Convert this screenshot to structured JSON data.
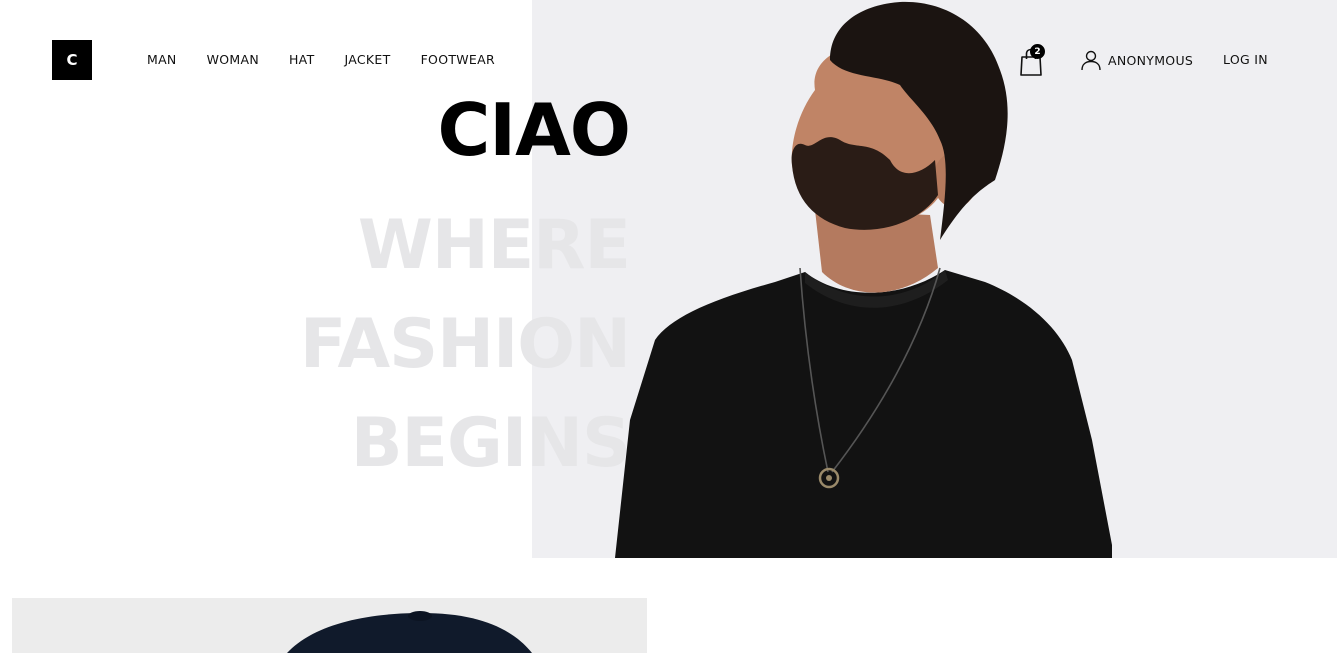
{
  "brand": {
    "logo_letter": "C"
  },
  "nav": {
    "items": [
      {
        "label": "MAN"
      },
      {
        "label": "WOMAN"
      },
      {
        "label": "HAT"
      },
      {
        "label": "JACKET"
      },
      {
        "label": "FOOTWEAR"
      }
    ]
  },
  "header": {
    "cart_count": "2",
    "account_label": "ANONYMOUS",
    "login_label": "LOG IN"
  },
  "hero": {
    "title": "CIAO",
    "tagline_lines": [
      "WHERE",
      "FASHION",
      "BEGINS"
    ]
  },
  "colors": {
    "hero_background": "#efeff2",
    "tagline": "#e6e6e8",
    "accent": "#000000"
  },
  "icons": {
    "cart": "shopping-bag-icon",
    "account": "user-icon"
  }
}
